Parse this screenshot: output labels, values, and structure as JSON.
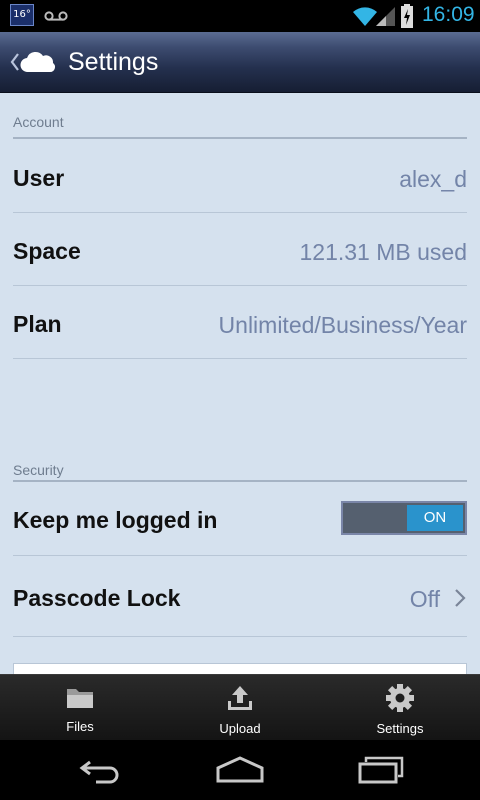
{
  "status_bar": {
    "weather_temp": "16°",
    "time": "16:09",
    "icons": [
      "voicemail-icon",
      "wifi-icon",
      "signal-icon",
      "battery-charging-icon"
    ],
    "accent_color": "#33b5e5"
  },
  "action_bar": {
    "title": "Settings",
    "icons": [
      "back-chevron-icon",
      "cloud-icon"
    ]
  },
  "sections": {
    "account": {
      "header": "Account",
      "rows": [
        {
          "label": "User",
          "value": "alex_d"
        },
        {
          "label": "Space",
          "value": "121.31 MB used"
        },
        {
          "label": "Plan",
          "value": "Unlimited/Business/Year"
        }
      ]
    },
    "security": {
      "header": "Security",
      "keep_logged_in": {
        "label": "Keep me logged in",
        "toggle_text": "ON",
        "toggle_state": true
      },
      "passcode_lock": {
        "label": "Passcode Lock",
        "value": "Off"
      }
    }
  },
  "tab_bar": {
    "tabs": [
      {
        "label": "Files",
        "icon": "folder-icon"
      },
      {
        "label": "Upload",
        "icon": "upload-icon"
      },
      {
        "label": "Settings",
        "icon": "gear-icon"
      }
    ]
  },
  "nav_bar": {
    "icons": [
      "back-icon",
      "home-icon",
      "recent-apps-icon"
    ]
  },
  "colors": {
    "content_bg": "#d5e1ee",
    "value_text": "#7384a8",
    "toggle_on": "#2a93cc"
  }
}
